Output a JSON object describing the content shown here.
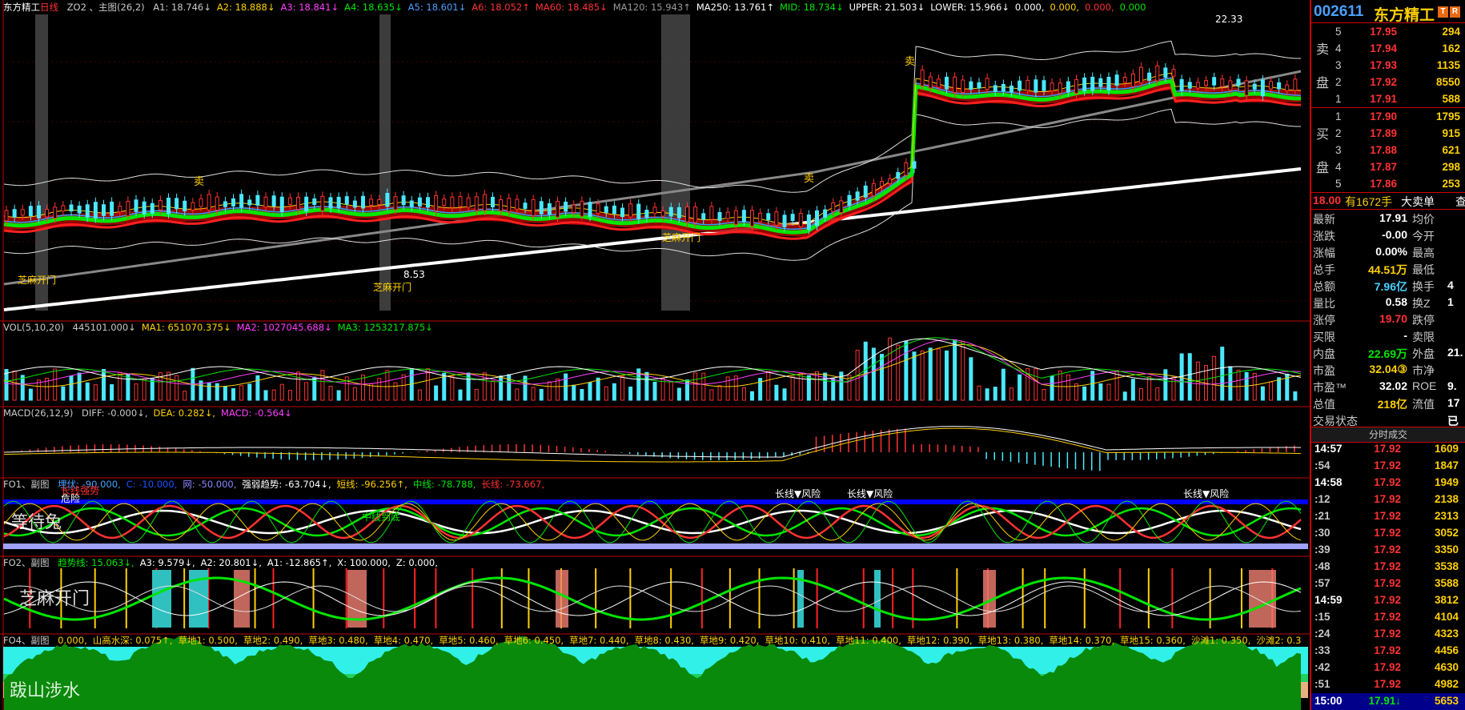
{
  "main_legend": {
    "stock": "东方精工",
    "period": "日线",
    "indicator": "ZO2 、主图(26,2)",
    "items": [
      {
        "text": "A1: 18.746↓",
        "color": "#c8c8c8"
      },
      {
        "text": "A2: 18.888↓",
        "color": "#ffd000"
      },
      {
        "text": "A3: 18.841↓",
        "color": "#ff40ff"
      },
      {
        "text": "A4: 18.635↓",
        "color": "#00e600"
      },
      {
        "text": "A5: 18.601↓",
        "color": "#4aa0ff"
      },
      {
        "text": "A6: 18.052↑",
        "color": "#ff3232"
      },
      {
        "text": "MA60: 18.485↓",
        "color": "#ff3232"
      },
      {
        "text": "MA120: 15.943↑",
        "color": "#999999"
      },
      {
        "text": "MA250: 13.761↑",
        "color": "#ffffff"
      },
      {
        "text": "MID: 18.734↓",
        "color": "#00e600"
      },
      {
        "text": "UPPER: 21.503↓",
        "color": "#ffffff"
      },
      {
        "text": "LOWER: 15.966↓",
        "color": "#ffffff"
      },
      {
        "text": "0.000,",
        "color": "#ffffff"
      },
      {
        "text": "0.000,",
        "color": "#ffd000"
      },
      {
        "text": "0.000,",
        "color": "#ff3232"
      },
      {
        "text": "0.000",
        "color": "#00e600"
      }
    ],
    "high_label": "22.33",
    "low_label": "8.53",
    "signals": [
      "芝麻开门",
      "芝麻开门",
      "芝麻开门",
      "卖",
      "卖",
      "卖"
    ]
  },
  "vol_legend": {
    "title": "VOL(5,10,20)",
    "items": [
      {
        "text": "445101.000↓",
        "color": "#c8c8c8"
      },
      {
        "text": "MA1: 651070.375↓",
        "color": "#ffd000"
      },
      {
        "text": "MA2: 1027045.688↓",
        "color": "#ff40ff"
      },
      {
        "text": "MA3: 1253217.875↓",
        "color": "#00e600"
      }
    ]
  },
  "macd_legend": {
    "title": "MACD(26,12,9)",
    "items": [
      {
        "text": "DIFF: -0.000↓,",
        "color": "#c8c8c8"
      },
      {
        "text": "DEA: 0.282↓,",
        "color": "#ffd000"
      },
      {
        "text": "MACD: -0.564↓",
        "color": "#ff40ff"
      }
    ]
  },
  "fo1_legend": {
    "title": "FO1、副图",
    "items": [
      {
        "text": "埋伏: -90.000,",
        "color": "#4aa0ff"
      },
      {
        "text": "C: -10.000,",
        "color": "#2050ff"
      },
      {
        "text": "网: -50.000,",
        "color": "#8888ff"
      },
      {
        "text": "强弱趋势: -63.704↓,",
        "color": "#ffffff"
      },
      {
        "text": "短线: -96.256↑,",
        "color": "#ffd000"
      },
      {
        "text": "中线: -78.788,",
        "color": "#00e600"
      },
      {
        "text": "长线: -73.667,",
        "color": "#ff3232"
      }
    ],
    "overlay": "等待兔",
    "signals": [
      "长线强势",
      "长线▼风险",
      "长线▼风险",
      "长线▼风险",
      "危险",
      "中线到底"
    ]
  },
  "fo2_legend": {
    "title": "FO2、副图",
    "items": [
      {
        "text": "趋势线: 15.063↓,",
        "color": "#00e600"
      },
      {
        "text": "A3: 9.579↓,",
        "color": "#ffffff"
      },
      {
        "text": "A2: 20.801↓,",
        "color": "#ffffff"
      },
      {
        "text": "A1: -12.865↑,",
        "color": "#ffffff"
      },
      {
        "text": "X: 100.000,",
        "color": "#ffffff"
      },
      {
        "text": "Z: 0.000,",
        "color": "#ffffff"
      }
    ],
    "overlay": "芝麻开门"
  },
  "fo4_legend": {
    "title": "FO4、副图",
    "items": [
      {
        "text": "0.000,",
        "color": "#ffd000"
      },
      {
        "text": "山高水深: 0.075↑,",
        "color": "#ffd000"
      },
      {
        "text": "草地1: 0.500,",
        "color": "#ffd000"
      },
      {
        "text": "草地2: 0.490,",
        "color": "#ffd000"
      },
      {
        "text": "草地3: 0.480,",
        "color": "#ffd000"
      },
      {
        "text": "草地4: 0.470,",
        "color": "#ffd000"
      },
      {
        "text": "草地5: 0.460,",
        "color": "#ffd000"
      },
      {
        "text": "草地6: 0.450,",
        "color": "#ffd000"
      },
      {
        "text": "草地7: 0.440,",
        "color": "#ffd000"
      },
      {
        "text": "草地8: 0.430,",
        "color": "#ffd000"
      },
      {
        "text": "草地9: 0.420,",
        "color": "#ffd000"
      },
      {
        "text": "草地10: 0.410,",
        "color": "#ffd000"
      },
      {
        "text": "草地11: 0.400,",
        "color": "#ffd000"
      },
      {
        "text": "草地12: 0.390,",
        "color": "#ffd000"
      },
      {
        "text": "草地13: 0.380,",
        "color": "#ffd000"
      },
      {
        "text": "草地14: 0.370,",
        "color": "#ffd000"
      },
      {
        "text": "草地15: 0.360,",
        "color": "#ffd000"
      },
      {
        "text": "沙滩1: 0.350,",
        "color": "#ffd000"
      },
      {
        "text": "沙滩2: 0.3",
        "color": "#ffd000"
      }
    ],
    "overlay": "跋山涉水"
  },
  "quote": {
    "code": "002611",
    "name": "东方精工",
    "tag1": "T",
    "tag2": "R",
    "sell_label": [
      "卖",
      "盘"
    ],
    "buy_label": [
      "买",
      "盘"
    ],
    "asks": [
      {
        "lv": "5",
        "price": "17.95",
        "vol": "294"
      },
      {
        "lv": "4",
        "price": "17.94",
        "vol": "162"
      },
      {
        "lv": "3",
        "price": "17.93",
        "vol": "1135"
      },
      {
        "lv": "2",
        "price": "17.92",
        "vol": "8550"
      },
      {
        "lv": "1",
        "price": "17.91",
        "vol": "588"
      }
    ],
    "bids": [
      {
        "lv": "1",
        "price": "17.90",
        "vol": "1795"
      },
      {
        "lv": "2",
        "price": "17.89",
        "vol": "915"
      },
      {
        "lv": "3",
        "price": "17.88",
        "vol": "621"
      },
      {
        "lv": "4",
        "price": "17.87",
        "vol": "298"
      },
      {
        "lv": "5",
        "price": "17.86",
        "vol": "253"
      }
    ],
    "big_order": {
      "price": "18.00",
      "text1": "有",
      "qty": "1672手",
      "text2": "大卖单",
      "more": "查"
    },
    "fields": [
      {
        "k": "最新",
        "v": "17.91",
        "vc": "#ffffff",
        "k2": "均价",
        "v2": ""
      },
      {
        "k": "涨跌",
        "v": "-0.00",
        "vc": "#ffffff",
        "k2": "今开",
        "v2": ""
      },
      {
        "k": "涨幅",
        "v": "0.00%",
        "vc": "#ffffff",
        "k2": "最高",
        "v2": ""
      },
      {
        "k": "总手",
        "v": "44.51万",
        "vc": "#ffd000",
        "k2": "最低",
        "v2": ""
      },
      {
        "k": "总额",
        "v": "7.96亿",
        "vc": "#4ad0ff",
        "k2": "换手",
        "v2": "4"
      },
      {
        "k": "量比",
        "v": "0.58",
        "vc": "#ffffff",
        "k2": "换Z",
        "v2": "1"
      },
      {
        "k": "涨停",
        "v": "19.70",
        "vc": "#ff3232",
        "k2": "跌停",
        "v2": ""
      },
      {
        "k": "买限",
        "v": "-",
        "vc": "#ffffff",
        "k2": "卖限",
        "v2": ""
      },
      {
        "k": "内盘",
        "v": "22.69万",
        "vc": "#00e600",
        "k2": "外盘",
        "v2": "21."
      },
      {
        "k": "市盈",
        "v": "32.04③",
        "vc": "#ffd000",
        "k2": "市净",
        "v2": ""
      },
      {
        "k": "市盈™",
        "v": "32.02",
        "vc": "#ffffff",
        "k2": "ROE",
        "v2": "9."
      },
      {
        "k": "总值",
        "v": "218亿",
        "vc": "#ffd000",
        "k2": "流值",
        "v2": "17"
      },
      {
        "k": "交易状态",
        "v": "",
        "vc": "#ffffff",
        "k2": "",
        "v2": "已"
      }
    ],
    "ticks_title": "分时成交",
    "ticks": [
      {
        "t": "14:57",
        "p": "17.92",
        "n": "1609"
      },
      {
        "t": ":54",
        "p": "17.92",
        "n": "1847"
      },
      {
        "t": "14:58",
        "p": "17.92",
        "n": "1949"
      },
      {
        "t": ":12",
        "p": "17.92",
        "n": "2138"
      },
      {
        "t": ":21",
        "p": "17.92",
        "n": "2313"
      },
      {
        "t": ":30",
        "p": "17.92",
        "n": "3052"
      },
      {
        "t": ":39",
        "p": "17.92",
        "n": "3350"
      },
      {
        "t": ":48",
        "p": "17.92",
        "n": "3538"
      },
      {
        "t": ":57",
        "p": "17.92",
        "n": "3588"
      },
      {
        "t": "14:59",
        "p": "17.92",
        "n": "3812"
      },
      {
        "t": ":15",
        "p": "17.92",
        "n": "4104"
      },
      {
        "t": ":24",
        "p": "17.92",
        "n": "4323"
      },
      {
        "t": ":33",
        "p": "17.92",
        "n": "4456"
      },
      {
        "t": ":42",
        "p": "17.92",
        "n": "4630"
      },
      {
        "t": ":51",
        "p": "17.92",
        "n": "4982"
      }
    ],
    "last_tick": {
      "t": "15:00",
      "p": "17.91↓",
      "n": "5653"
    }
  },
  "colors": {
    "up": "#ff3232",
    "down": "#4ae8ff",
    "ma_green": "#00e600",
    "yellow": "#ffd000",
    "panel_line": "#c00000"
  }
}
